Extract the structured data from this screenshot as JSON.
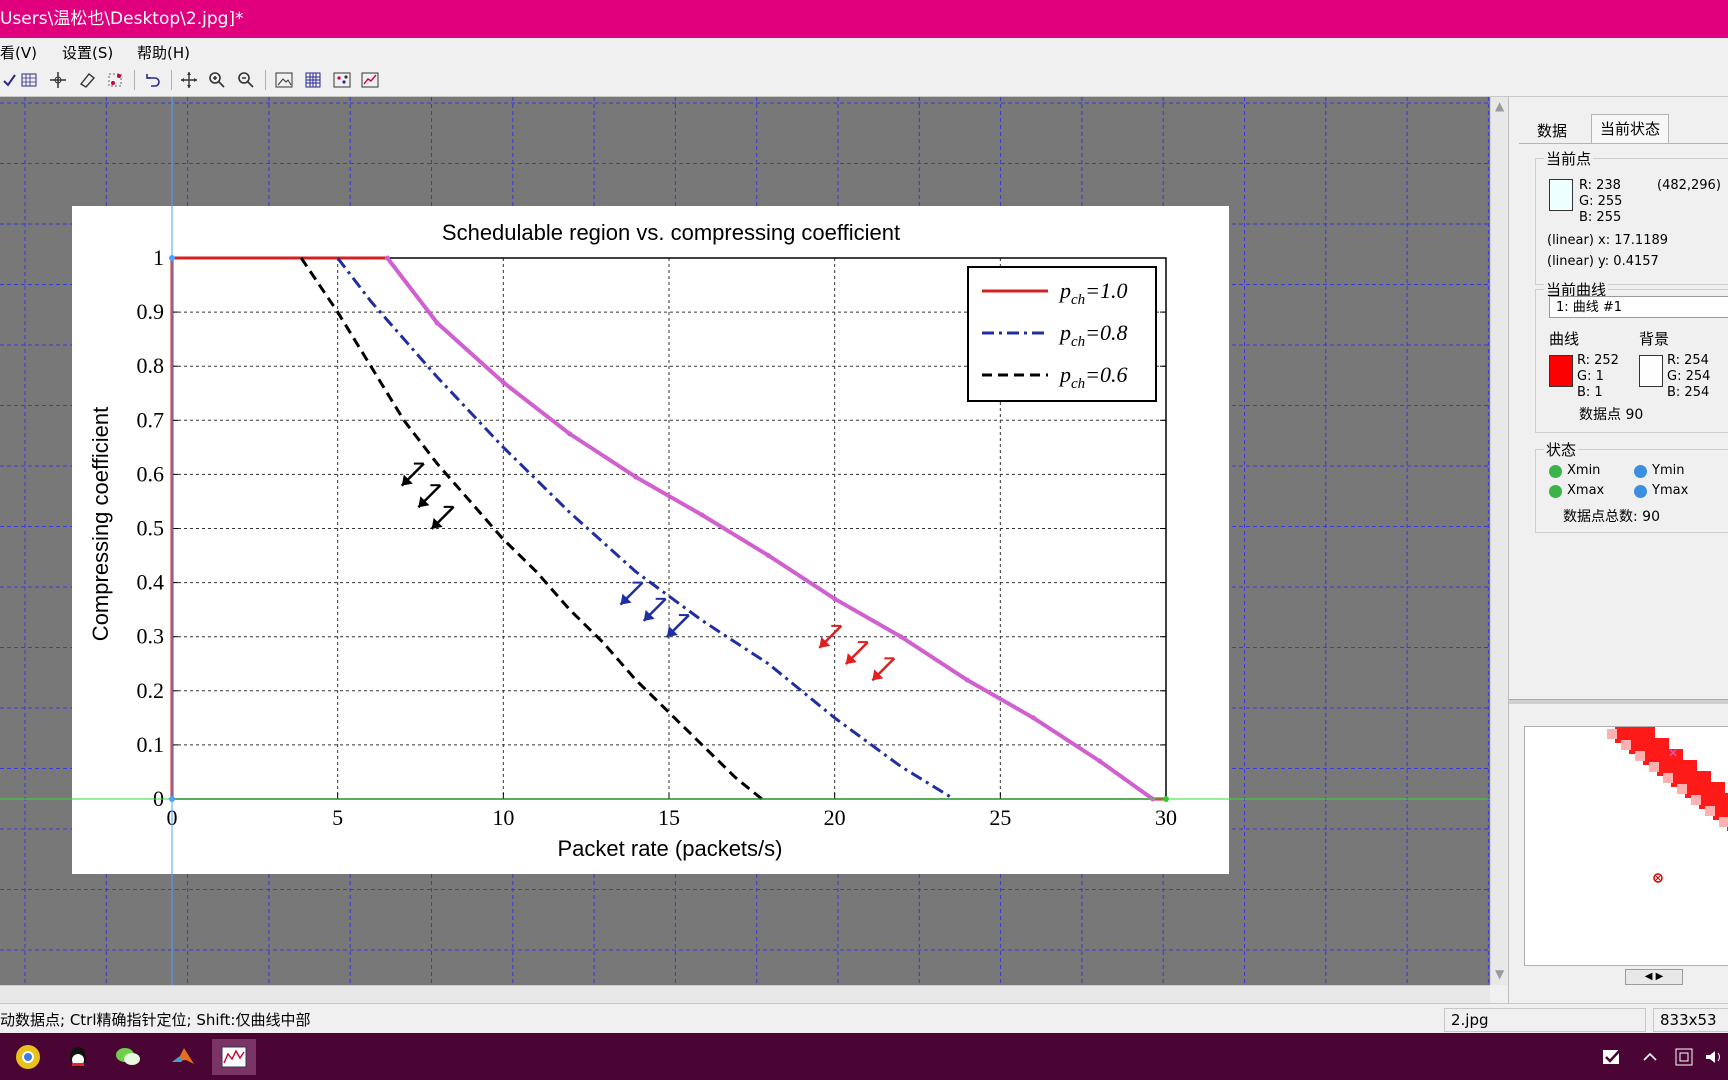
{
  "window": {
    "title": "Users\\温松也\\Desktop\\2.jpg]*"
  },
  "menu": {
    "items": [
      "看(V)",
      "设置(S)",
      "帮助(H)"
    ]
  },
  "toolbar": {
    "icons": [
      "check-icon",
      "grid-curve-icon",
      "crosshair-icon",
      "eraser-icon",
      "scatter-select-icon",
      "undo-icon",
      "move-icon",
      "zoom-in-icon",
      "zoom-out-icon",
      "image-icon",
      "grid-icon",
      "points-icon",
      "chart-icon"
    ]
  },
  "chart": {
    "title": "Schedulable region vs. compressing coefficient",
    "xlabel": "Packet rate (packets/s)",
    "ylabel": "Compressing coefficient",
    "x_ticks": [
      "0",
      "5",
      "10",
      "15",
      "20",
      "25",
      "30"
    ],
    "y_ticks": [
      "0",
      "0.1",
      "0.2",
      "0.3",
      "0.4",
      "0.5",
      "0.6",
      "0.7",
      "0.8",
      "0.9",
      "1"
    ],
    "legend": [
      {
        "p": "p",
        "sub": "ch",
        "eq": "=1.0"
      },
      {
        "p": "p",
        "sub": "ch",
        "eq": "=0.8"
      },
      {
        "p": "p",
        "sub": "ch",
        "eq": "=0.6"
      }
    ]
  },
  "chart_data": {
    "type": "line",
    "title": "Schedulable region vs. compressing coefficient",
    "xlabel": "Packet rate (packets/s)",
    "ylabel": "Compressing coefficient",
    "xlim": [
      0,
      30
    ],
    "ylim": [
      0,
      1
    ],
    "grid": true,
    "legend_position": "top-right",
    "series": [
      {
        "name": "p_ch=1.0",
        "color": "#d62020",
        "style": "solid",
        "x": [
          0,
          0,
          6.5,
          8,
          10,
          12,
          14,
          16,
          18,
          20,
          22,
          24,
          26,
          28,
          29.6,
          30
        ],
        "y": [
          0,
          1,
          1,
          0.88,
          0.77,
          0.675,
          0.595,
          0.525,
          0.45,
          0.37,
          0.3,
          0.22,
          0.15,
          0.07,
          0,
          0
        ]
      },
      {
        "name": "p_ch=0.8",
        "color": "#1f2ea0",
        "style": "dashdot",
        "x": [
          5,
          6,
          8,
          10,
          12,
          14,
          16,
          18,
          20,
          22,
          23.6
        ],
        "y": [
          1,
          0.92,
          0.78,
          0.65,
          0.53,
          0.42,
          0.33,
          0.25,
          0.15,
          0.06,
          0
        ]
      },
      {
        "name": "p_ch=0.6",
        "color": "#000000",
        "style": "dashed",
        "x": [
          3.9,
          5,
          6,
          7,
          8,
          9,
          10,
          11,
          12,
          13,
          14,
          15,
          16,
          17,
          17.8
        ],
        "y": [
          1,
          0.9,
          0.8,
          0.7,
          0.62,
          0.55,
          0.48,
          0.42,
          0.35,
          0.29,
          0.22,
          0.16,
          0.1,
          0.04,
          0
        ]
      }
    ],
    "digitized_curve": {
      "color": "#d060d0",
      "x": [
        6.5,
        8,
        10,
        12,
        14,
        16,
        18,
        20,
        22,
        24,
        26,
        28,
        29.6
      ],
      "y": [
        1,
        0.88,
        0.77,
        0.675,
        0.595,
        0.525,
        0.45,
        0.37,
        0.3,
        0.22,
        0.15,
        0.07,
        0
      ]
    }
  },
  "panel": {
    "tabs": [
      "数据",
      "当前状态"
    ],
    "current_point": {
      "title": "当前点",
      "r": "R: 238",
      "g": "G: 255",
      "b": "B: 255",
      "coords": "(482,296)",
      "x": "(linear)  x: 17.1189",
      "y": "(linear)  y: 0.4157",
      "swatch_color": "#eeffff"
    },
    "current_curve": {
      "title": "当前曲线",
      "select_value": "1: 曲线 #1",
      "curve_label": "曲线",
      "bg_label": "背景",
      "curve_r": "R: 252",
      "curve_g": "G: 1",
      "curve_b": "B: 1",
      "bg_r": "R: 254",
      "bg_g": "G: 254",
      "bg_b": "B: 254",
      "points": "数据点  90",
      "curve_color": "#fc0101",
      "bg_color": "#fefefe"
    },
    "status": {
      "title": "状态",
      "xmin": "Xmin",
      "xmax": "Xmax",
      "ymin": "Ymin",
      "ymax": "Ymax",
      "total": "数据点总数:    90"
    }
  },
  "statusbar": {
    "hint": "动数据点; Ctrl精确指针定位; Shift:仅曲线中部",
    "file": "2.jpg",
    "size": "833x53"
  }
}
